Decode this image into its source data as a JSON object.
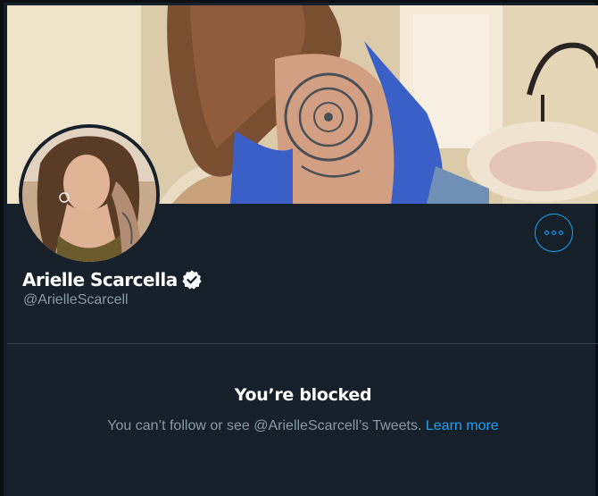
{
  "profile": {
    "display_name": "Arielle Scarcella",
    "handle": "@ArielleScarcell",
    "verified": true
  },
  "icons": {
    "more": "more-horizontal-icon",
    "verified": "verified-badge-icon"
  },
  "blocked": {
    "title": "You’re blocked",
    "message": "You can’t follow or see @ArielleScarcell’s Tweets.",
    "link_label": "Learn more"
  },
  "colors": {
    "background": "#15202b",
    "accent": "#1da1f2",
    "secondary_text": "#8899a6",
    "divider": "#38444d"
  }
}
